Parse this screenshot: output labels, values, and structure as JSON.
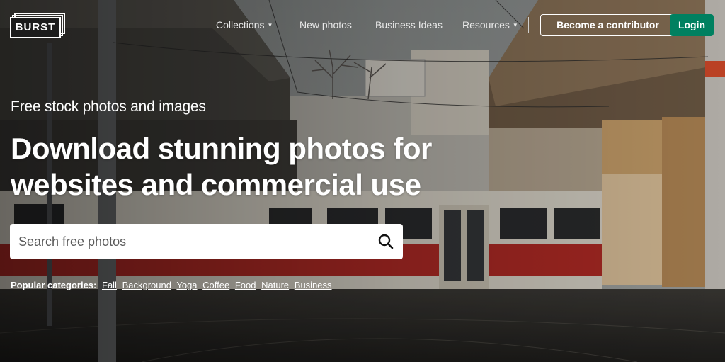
{
  "brand": {
    "logo_text": "BURST"
  },
  "nav": {
    "items": [
      {
        "label": "Collections",
        "has_dropdown": true
      },
      {
        "label": "New photos",
        "has_dropdown": false
      },
      {
        "label": "Business Ideas",
        "has_dropdown": false
      },
      {
        "label": "Resources",
        "has_dropdown": true
      }
    ],
    "contributor_button": "Become a contributor",
    "login_button": "Login"
  },
  "hero": {
    "eyebrow": "Free stock photos and images",
    "headline_line1": "Download stunning photos for",
    "headline_line2": "websites and commercial use"
  },
  "search": {
    "placeholder": "Search free photos",
    "value": "",
    "icon": "search-icon"
  },
  "popular": {
    "label": "Popular categories:",
    "categories": [
      "Fall",
      "Background",
      "Yoga",
      "Coffee",
      "Food",
      "Nature",
      "Business"
    ]
  },
  "colors": {
    "accent": "#008060",
    "text": "#ffffff",
    "search_bg": "#ffffff"
  }
}
